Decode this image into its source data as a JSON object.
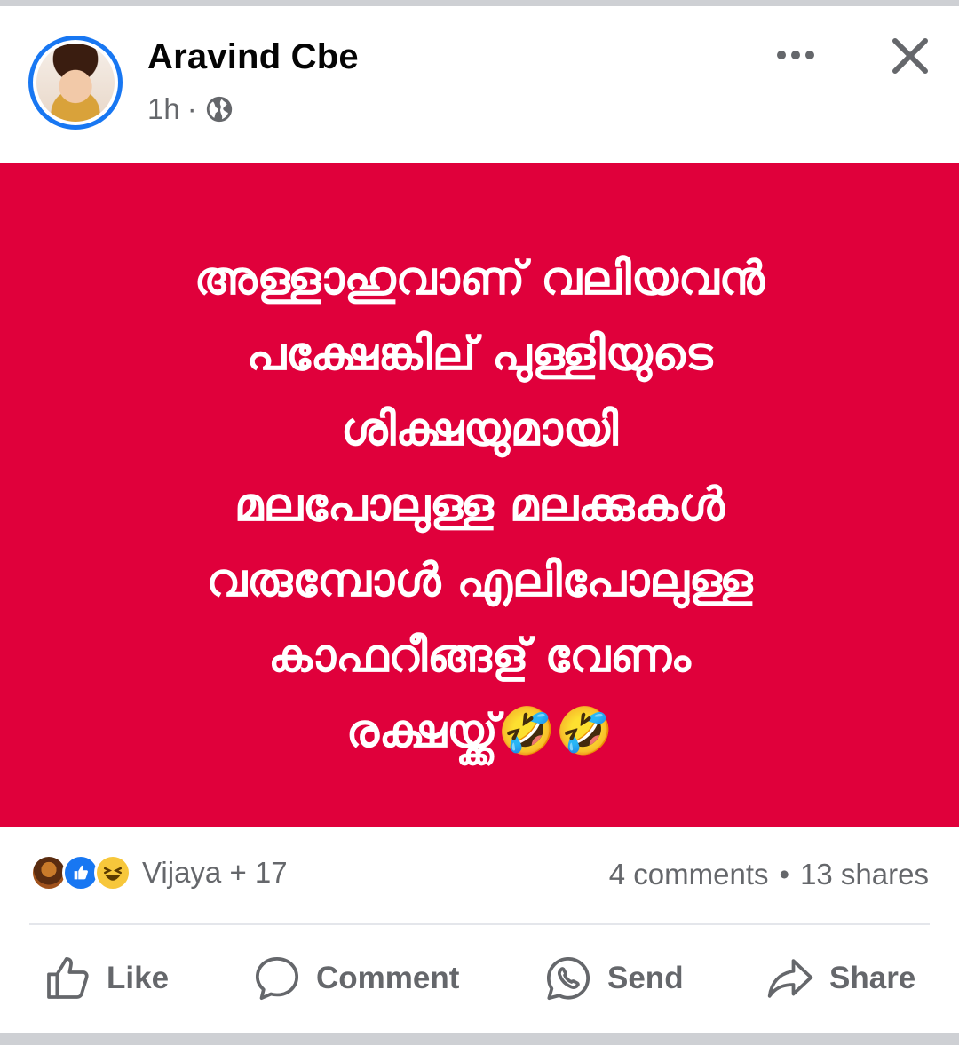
{
  "post": {
    "author": "Aravind Cbe",
    "time": "1h",
    "separator": "·",
    "text_lines": [
      "അള്ളാഹുവാണ് വലിയവൻ",
      "പക്ഷേങ്കില് പുള്ളിയുടെ",
      "ശിക്ഷയുമായി",
      "മലപോലുള്ള മലക്കുകൾ",
      "വരുമ്പോൾ എലിപോലുള്ള",
      "കാഫറീങ്ങള് വേണം",
      "രക്ഷയ്ക്ക്🤣🤣"
    ],
    "background_color": "#e0003b"
  },
  "reactions": {
    "names": "Vijaya + 17",
    "comments": "4 comments",
    "dot": "•",
    "shares": "13 shares"
  },
  "actions": {
    "like": "Like",
    "comment": "Comment",
    "send": "Send",
    "share": "Share"
  },
  "colors": {
    "accent": "#1877f2",
    "muted_text": "#65676b"
  }
}
